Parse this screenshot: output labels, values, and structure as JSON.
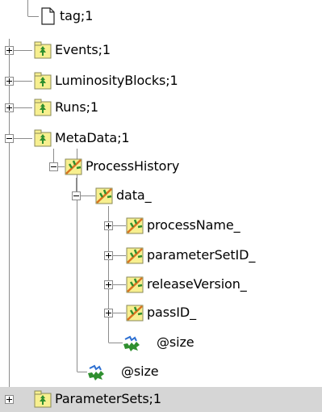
{
  "tree": {
    "nodes": [
      {
        "label": "tag;1",
        "icon": "leaf-document-icon",
        "expanded": null
      },
      {
        "label": "Events;1",
        "icon": "tree-folder-icon",
        "expanded": false
      },
      {
        "label": "LuminosityBlocks;1",
        "icon": "tree-folder-icon",
        "expanded": false
      },
      {
        "label": "Runs;1",
        "icon": "tree-folder-icon",
        "expanded": false
      },
      {
        "label": "MetaData;1",
        "icon": "tree-folder-icon",
        "expanded": true
      },
      {
        "label": "ProcessHistory",
        "icon": "branch-icon",
        "expanded": true
      },
      {
        "label": "data_",
        "icon": "branch-icon",
        "expanded": true
      },
      {
        "label": "processName_",
        "icon": "branch-icon",
        "expanded": false
      },
      {
        "label": "parameterSetID_",
        "icon": "branch-icon",
        "expanded": false
      },
      {
        "label": "releaseVersion_",
        "icon": "branch-icon",
        "expanded": false
      },
      {
        "label": "passID_",
        "icon": "branch-icon",
        "expanded": false
      },
      {
        "label": "@size",
        "icon": "leaf-icon",
        "expanded": null
      },
      {
        "label": "@size",
        "icon": "leaf-icon",
        "expanded": null
      },
      {
        "label": "ParameterSets;1",
        "icon": "tree-folder-icon",
        "expanded": false,
        "selected": true
      }
    ]
  },
  "colors": {
    "selection": "#d6d6d6",
    "connector": "#8c8c8c",
    "folder_fill": "#f7ef8f",
    "folder_border": "#8a8a5a",
    "tree_green": "#2f8f2f",
    "branch_orange": "#d9731f",
    "leaf_blue": "#2d6fd1"
  }
}
